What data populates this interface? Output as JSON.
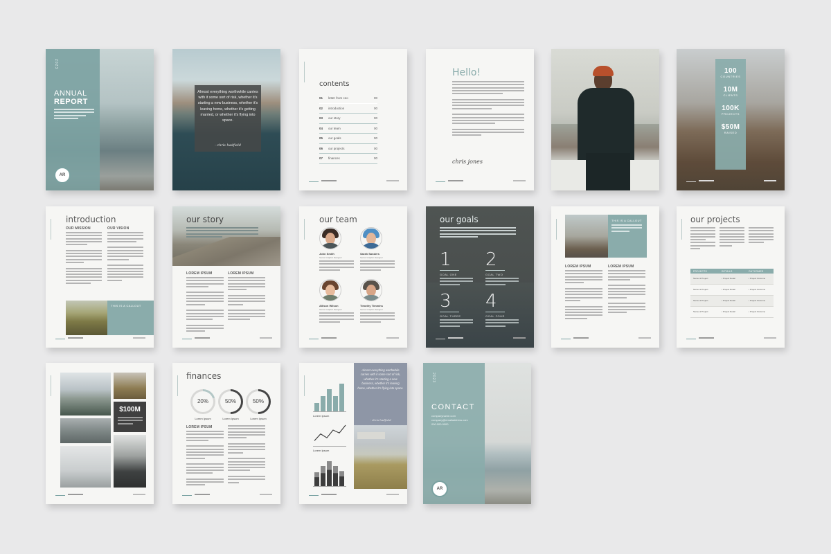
{
  "pages": {
    "cover": {
      "year": "2023",
      "title_line1": "ANNUAL",
      "title_line2": "REPORT",
      "logo_letters": "AR"
    },
    "quote": {
      "text": "Almost everything worthwhile carries with it some sort of risk, whether it's starting a new business, whether it's leaving home, whether it's getting married, or whether it's flying into space.",
      "signature": "- chris hadfield"
    },
    "contents": {
      "title": "contents",
      "items": [
        {
          "num": "01",
          "label": "letter from ceo",
          "page": "00"
        },
        {
          "num": "02",
          "label": "introduction",
          "page": "00"
        },
        {
          "num": "03",
          "label": "our story",
          "page": "00"
        },
        {
          "num": "04",
          "label": "our team",
          "page": "00"
        },
        {
          "num": "05",
          "label": "our goals",
          "page": "00"
        },
        {
          "num": "06",
          "label": "our projects",
          "page": "00"
        },
        {
          "num": "07",
          "label": "finances",
          "page": "00"
        }
      ]
    },
    "hello": {
      "title": "Hello!",
      "signature": "chris jones"
    },
    "stats": {
      "items": [
        {
          "value": "100",
          "label": "COUNTRIES"
        },
        {
          "value": "10M",
          "label": "CLIENTS"
        },
        {
          "value": "100K",
          "label": "PROJECTS"
        },
        {
          "value": "$50M",
          "label": "RAISED"
        }
      ]
    },
    "introduction": {
      "title": "introduction",
      "mission": "OUR MISSION",
      "vision": "OUR VISION",
      "callout": "THIS IS A CALLOUT"
    },
    "story": {
      "title": "our story",
      "col1": "LOREM IPSUM",
      "col2": "LOREM IPSUM"
    },
    "team": {
      "title": "our team",
      "members": [
        {
          "name": "John Smith",
          "role": "Senior Graphic Designer"
        },
        {
          "name": "Sarah Sanders",
          "role": "Senior Graphic Designer"
        },
        {
          "name": "Allison Wilson",
          "role": "Senior Graphic Designer"
        },
        {
          "name": "Timothy Timmins",
          "role": "Senior Graphic Designer"
        }
      ]
    },
    "goals": {
      "title": "our goals",
      "items": [
        {
          "num": "1",
          "label": "GOAL ONE"
        },
        {
          "num": "2",
          "label": "GOAL TWO"
        },
        {
          "num": "3",
          "label": "GOAL THREE"
        },
        {
          "num": "4",
          "label": "GOAL FOUR"
        }
      ]
    },
    "callout_page": {
      "callout": "THIS IS A CALLOUT",
      "col1": "LOREM IPSUM",
      "col2": "LOREM IPSUM"
    },
    "projects": {
      "title": "our projects",
      "headers": [
        "PROJECTS",
        "DETAILS",
        "OUTCOMES"
      ],
      "rows": [
        {
          "name": "Name of Project",
          "detail": "• Project Detail",
          "outcome": "• Project Outcome"
        },
        {
          "name": "Name of Project",
          "detail": "• Project Detail",
          "outcome": "• Project Outcome"
        },
        {
          "name": "Name of Project",
          "detail": "• Project Detail",
          "outcome": "• Project Outcome"
        },
        {
          "name": "Name of Project",
          "detail": "• Project Detail",
          "outcome": "• Project Outcome"
        }
      ]
    },
    "gallery": {
      "amount": "$100M"
    },
    "finances": {
      "title": "finances",
      "rings": [
        {
          "value": "20%",
          "label": "Lorem Ipsum",
          "fraction": 0.2
        },
        {
          "value": "50%",
          "label": "Lorem Ipsum",
          "fraction": 0.5
        },
        {
          "value": "50%",
          "label": "Lorem Ipsum",
          "fraction": 0.5
        }
      ],
      "heading": "LOREM IPSUM"
    },
    "charts": {
      "quote": "Almost everything worthwhile carries with it some sort of risk, whether it's starting a new business, whether it's leaving home, whether it's flying into space.",
      "signature": "- chris hadfield",
      "label1": "Lorem Ipsum",
      "label2": "Lorem Ipsum",
      "label3": "Lorem Ipsum",
      "bars1": [
        0.3,
        0.55,
        0.8,
        0.55,
        1.0
      ],
      "line": [
        0.2,
        0.55,
        0.35,
        0.75,
        0.6,
        1.0
      ],
      "bars3": [
        0.55,
        0.8,
        1.0,
        0.8,
        0.6
      ]
    },
    "contact": {
      "year": "2023",
      "title": "CONTACT",
      "lines": [
        "companyname.com",
        "company@emailaddress.com",
        "000.000.0000"
      ],
      "logo_letters": "AR"
    }
  },
  "colors": {
    "accent": "#8aacab",
    "accent_light": "#b3c7c6",
    "dark_panel": "#464a49"
  }
}
